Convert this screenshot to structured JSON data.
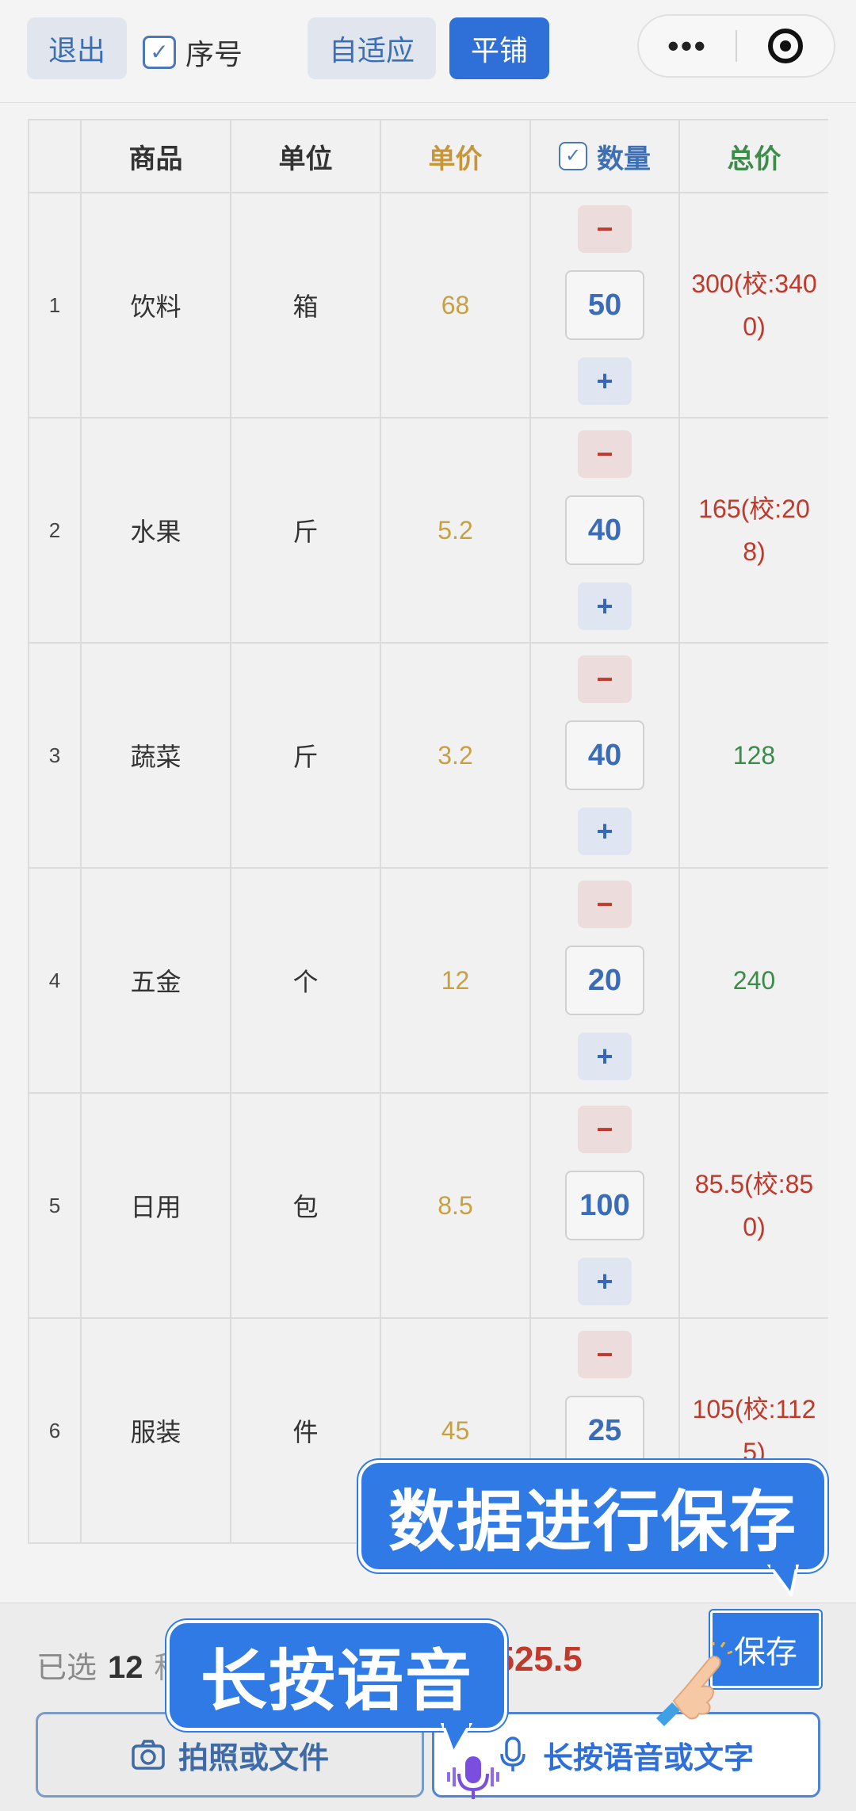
{
  "toolbar": {
    "exit_label": "退出",
    "serial_label": "序号",
    "serial_checked": true,
    "fit_label": "自适应",
    "tile_label": "平铺",
    "menu_icon": "more-dots-icon",
    "close_icon": "target-icon"
  },
  "table": {
    "headers": {
      "index": "",
      "name": "商品",
      "unit": "单位",
      "price": "单价",
      "qty": "数量",
      "total": "总价"
    },
    "minus_label": "−",
    "plus_label": "+",
    "rows": [
      {
        "index": "1",
        "name": "饮料",
        "unit": "箱",
        "price": "68",
        "qty": "50",
        "total": "300(校:3400)",
        "status": "mismatch"
      },
      {
        "index": "2",
        "name": "水果",
        "unit": "斤",
        "price": "5.2",
        "qty": "40",
        "total": "165(校:208)",
        "status": "mismatch"
      },
      {
        "index": "3",
        "name": "蔬菜",
        "unit": "斤",
        "price": "3.2",
        "qty": "40",
        "total": "128",
        "status": "ok"
      },
      {
        "index": "4",
        "name": "五金",
        "unit": "个",
        "price": "12",
        "qty": "20",
        "total": "240",
        "status": "ok"
      },
      {
        "index": "5",
        "name": "日用",
        "unit": "包",
        "price": "8.5",
        "qty": "100",
        "total": "85.5(校:850)",
        "status": "mismatch"
      },
      {
        "index": "6",
        "name": "服装",
        "unit": "件",
        "price": "45",
        "qty": "25",
        "total": "105(校:1125)",
        "status": "mismatch"
      }
    ]
  },
  "bottom": {
    "selected_prefix": "已选",
    "selected_count": "12",
    "selected_suffix": "种",
    "total_amount": "6525.5",
    "save_label": "保存",
    "photo_label": "拍照或文件",
    "voice_label": "长按语音或文字"
  },
  "overlay": {
    "save_tip": "数据进行保存",
    "voice_tip": "长按语音"
  },
  "colors": {
    "primary": "#2f7ae5",
    "mismatch": "#c0392b",
    "ok": "#3a8c48",
    "price": "#c9a040"
  }
}
